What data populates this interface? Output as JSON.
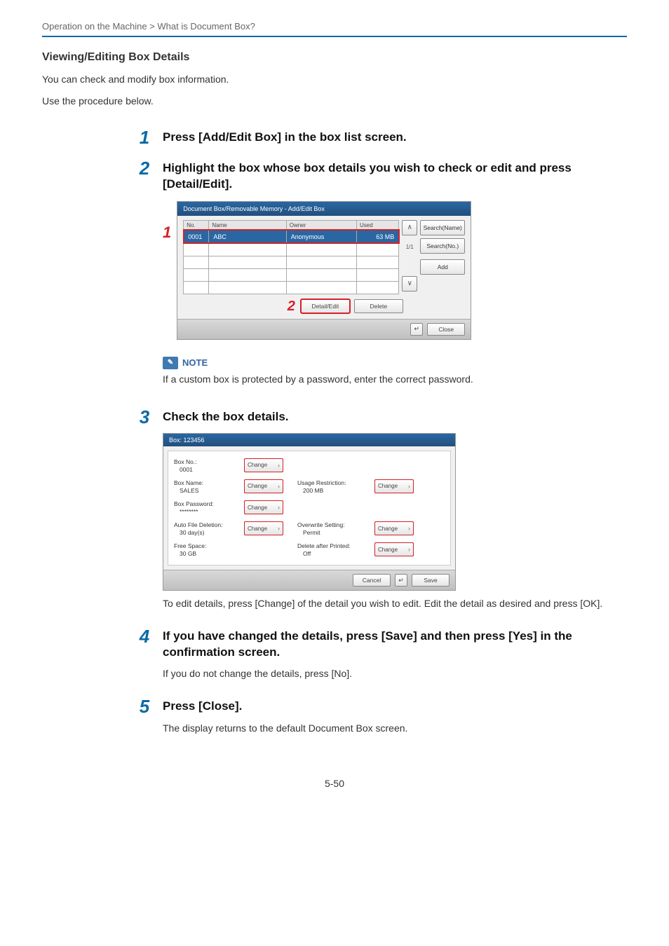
{
  "breadcrumb": "Operation on the Machine > What is Document Box?",
  "heading": "Viewing/Editing Box Details",
  "intro1": "You can check and modify box information.",
  "intro2": "Use the procedure below.",
  "steps": {
    "s1": {
      "num": "1",
      "title": "Press [Add/Edit Box] in the box list screen."
    },
    "s2": {
      "num": "2",
      "title": "Highlight the box whose box details you wish to check or edit and press [Detail/Edit]."
    },
    "s3": {
      "num": "3",
      "title": "Check the box details.",
      "desc": "To edit details, press [Change] of the detail you wish to edit. Edit the detail as desired and press [OK]."
    },
    "s4": {
      "num": "4",
      "title": "If you have changed the details, press [Save] and then press [Yes] in the confirmation screen.",
      "desc": "If you do not change the details, press [No]."
    },
    "s5": {
      "num": "5",
      "title": "Press [Close].",
      "desc": "The display returns to the default Document Box screen."
    }
  },
  "screen1": {
    "title": "Document Box/Removable Memory - Add/Edit Box",
    "callout1": "1",
    "callout2": "2",
    "cols": {
      "no": "No.",
      "name": "Name",
      "owner": "Owner",
      "used": "Used"
    },
    "row": {
      "no": "0001",
      "name": "ABC",
      "owner": "Anonymous",
      "used": "63 MB"
    },
    "btns": {
      "searchName": "Search(Name)",
      "searchNo": "Search(No.)",
      "add": "Add",
      "page": "1/1",
      "detailEdit": "Detail/Edit",
      "delete": "Delete",
      "close": "Close",
      "enter": "↵"
    }
  },
  "note": {
    "label": "NOTE",
    "text": "If a custom box is protected by a password, enter the correct password."
  },
  "screen2": {
    "title": "Box:      123456",
    "rows": {
      "boxNo": {
        "label": "Box No.:",
        "value": "0001"
      },
      "boxName": {
        "label": "Box Name:",
        "value": "SALES"
      },
      "boxPassword": {
        "label": "Box Password:",
        "value": "********"
      },
      "autoFileDel": {
        "label": "Auto File Deletion:",
        "value": "30  day(s)"
      },
      "freeSpace": {
        "label": "Free Space:",
        "value": "30  GB"
      },
      "usageRestr": {
        "label": "Usage Restriction:",
        "value": "200  MB"
      },
      "overwrite": {
        "label": "Overwrite Setting:",
        "value": "Permit"
      },
      "deleteAfter": {
        "label": "Delete after Printed:",
        "value": "Off"
      }
    },
    "change": "Change",
    "foot": {
      "cancel": "Cancel",
      "save": "Save",
      "enter": "↵"
    }
  },
  "pageNum": "5-50"
}
